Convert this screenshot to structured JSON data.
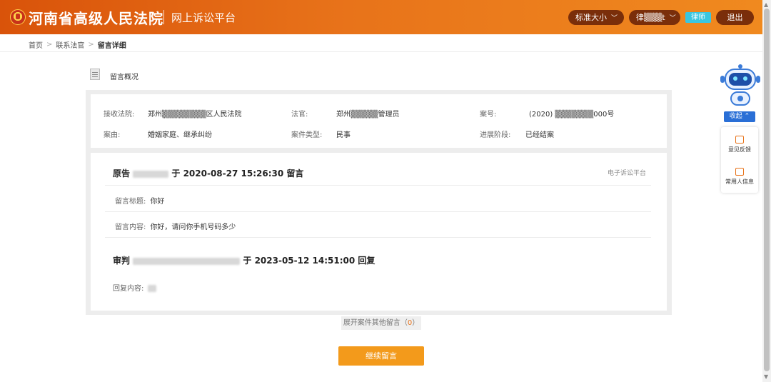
{
  "header": {
    "court_name": "河南省高级人民法院",
    "platform_name": "网上诉讼平台",
    "font_size_label": "标准大小",
    "user_label": "律▒▒▒t",
    "role_badge": "律师",
    "logout_label": "退出"
  },
  "breadcrumb": {
    "home": "首页",
    "contact": "联系法官",
    "current": "留言详细"
  },
  "overview": {
    "title": "留言概况",
    "court_label": "接收法院:",
    "court_value": "郑州▒▒▒▒▒▒▒▒区人民法院",
    "judge_label": "法官:",
    "judge_value": "郑州▒▒▒▒▒管理员",
    "case_no_label": "案号:",
    "case_no_value": "(2020) ▒▒▒▒▒▒▒000号",
    "cause_label": "案由:",
    "cause_value": "婚姻家庭、继承纠纷",
    "case_type_label": "案件类型:",
    "case_type_value": "民事",
    "stage_label": "进展阶段:",
    "stage_value": "已经结案"
  },
  "message": {
    "prefix": "原告",
    "suffix": "于 2020-08-27 15:26:30 留言",
    "source": "电子诉讼平台",
    "title_label": "留言标题:",
    "title_value": "你好",
    "content_label": "留言内容:",
    "content_value": "你好，请问你手机号码多少"
  },
  "reply": {
    "prefix": "审判",
    "suffix": "于 2023-05-12 14:51:00 回复",
    "content_label": "回复内容:"
  },
  "expand": {
    "label": "展开案件其他留言",
    "count": "0"
  },
  "continue_label": "继续留言",
  "side": {
    "collapse_label": "收起",
    "feedback_label": "意见反馈",
    "contacts_label": "常用人信息"
  },
  "colors": {
    "header_start": "#d9530a",
    "header_end": "#f08a1f",
    "accent": "#f39a1b",
    "badge": "#3ac6e0",
    "collapse": "#2a6fd6"
  }
}
